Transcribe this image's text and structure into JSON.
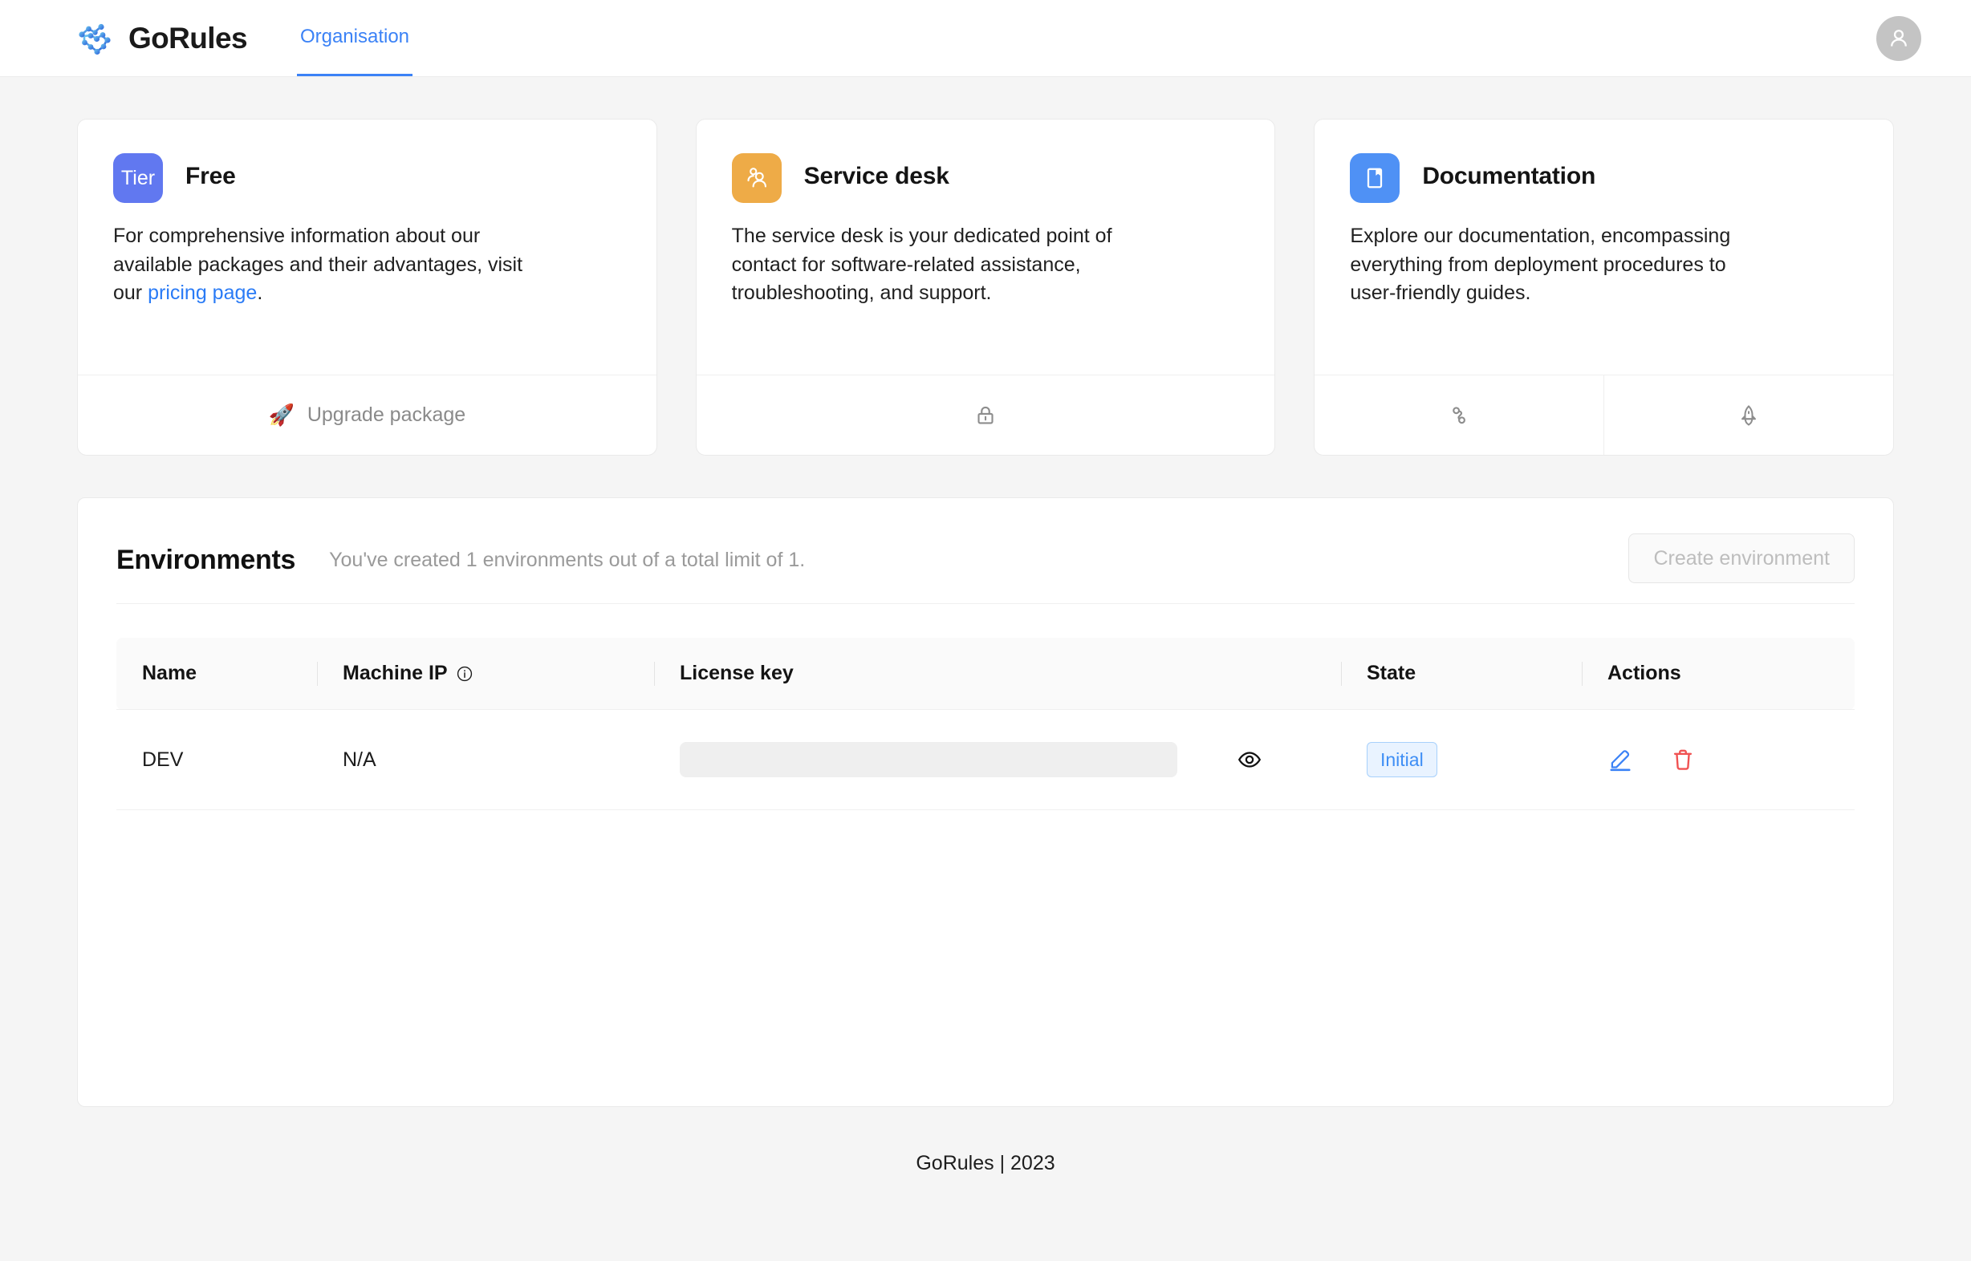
{
  "header": {
    "logo_text": "GoRules",
    "logo_icon": "gorules-network-logo",
    "tabs": [
      {
        "label": "Organisation",
        "active": true
      }
    ],
    "avatar_icon": "user-avatar-icon"
  },
  "cards": [
    {
      "id": "tier",
      "icon_label": "Tier",
      "icon_name": "tier-badge-icon",
      "icon_color": "#6178f0",
      "title": "Free",
      "body_before_link": "For comprehensive information about our available packages and their advantages, visit our ",
      "link_text": "pricing page",
      "body_after_link": ".",
      "footer_actions": [
        {
          "icon": "rocket-emoji",
          "glyph": "🚀",
          "label": "Upgrade package"
        }
      ]
    },
    {
      "id": "service-desk",
      "icon_name": "users-icon",
      "icon_color": "#eeab47",
      "title": "Service desk",
      "body": "The service desk is your dedicated point of contact for software-related assistance, troubleshooting, and support.",
      "footer_actions": [
        {
          "icon": "lock-icon",
          "label": ""
        }
      ]
    },
    {
      "id": "documentation",
      "icon_name": "book-bookmark-icon",
      "icon_color": "#4f91f5",
      "title": "Documentation",
      "body": "Explore our documentation, encompassing everything from deployment procedures to user-friendly guides.",
      "footer_actions": [
        {
          "icon": "flow-node-icon",
          "label": ""
        },
        {
          "icon": "rocket-outline-icon",
          "label": ""
        }
      ]
    }
  ],
  "environments": {
    "title": "Environments",
    "subtitle": "You've created 1 environments out of a total limit of 1.",
    "create_button": "Create environment",
    "create_button_disabled": true,
    "table": {
      "columns": [
        "Name",
        "Machine IP",
        "License key",
        "State",
        "Actions"
      ],
      "machine_ip_info_icon": "info-circle-icon",
      "rows": [
        {
          "name": "DEV",
          "machine_ip": "N/A",
          "license_key": "",
          "license_key_masked": true,
          "reveal_icon": "eye-icon",
          "state": "Initial",
          "actions": [
            "edit-pencil-icon",
            "delete-trash-icon"
          ]
        }
      ]
    }
  },
  "footer": {
    "text": "GoRules | 2023"
  },
  "colors": {
    "accent_blue": "#3b82f6",
    "link_blue": "#2a7bf6",
    "tier_purple": "#6178f0",
    "desk_orange": "#eeab47",
    "docs_blue": "#4f91f5",
    "badge_blue": "#3e8ef5",
    "danger_red": "#f05252",
    "page_bg": "#f5f5f5"
  }
}
